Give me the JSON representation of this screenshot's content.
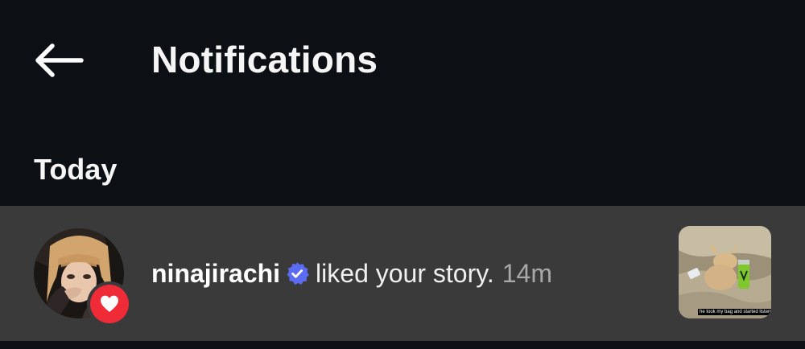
{
  "header": {
    "title": "Notifications",
    "back_icon": "arrow-left-icon"
  },
  "sections": [
    {
      "label": "Today",
      "items": [
        {
          "username": "ninajirachi",
          "verified": true,
          "action": "liked your story.",
          "time": "14m",
          "badge_icon": "heart-icon",
          "badge_color": "#ef2b38",
          "thumbnail_caption": "he took my bag and started listening to"
        }
      ]
    }
  ],
  "colors": {
    "background": "#0c0f14",
    "row_highlight": "#3a3a3a",
    "verified_blue": "#5b6cf2",
    "timestamp": "#a8a8a8"
  }
}
